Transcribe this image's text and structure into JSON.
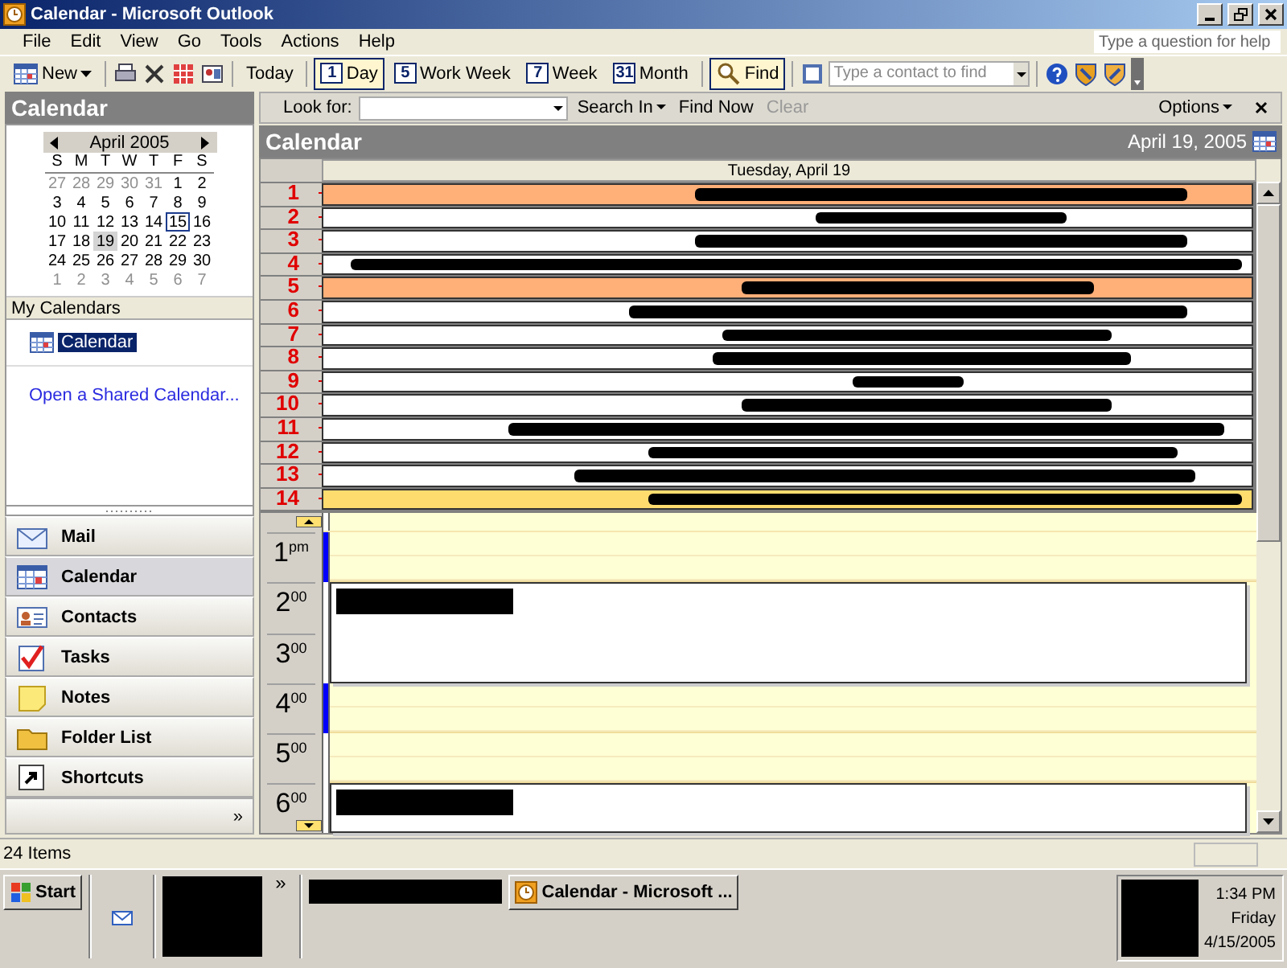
{
  "window": {
    "title": "Calendar - Microsoft Outlook"
  },
  "menu": [
    "File",
    "Edit",
    "View",
    "Go",
    "Tools",
    "Actions",
    "Help"
  ],
  "help_box": {
    "placeholder": "Type a question for help"
  },
  "toolbar": {
    "new_label": "New",
    "today_label": "Today",
    "views": [
      {
        "label": "Day",
        "icon_text": "1",
        "selected": true
      },
      {
        "label": "Work Week",
        "icon_text": "5",
        "selected": false
      },
      {
        "label": "Week",
        "icon_text": "7",
        "selected": false
      },
      {
        "label": "Month",
        "icon_text": "31",
        "selected": false
      }
    ],
    "find": {
      "label": "Find",
      "selected": true
    },
    "contact_search": {
      "placeholder": "Type a contact to find"
    }
  },
  "sidebar": {
    "title": "Calendar",
    "mini_calendar": {
      "month": "April 2005",
      "weekdays": [
        "S",
        "M",
        "T",
        "W",
        "T",
        "F",
        "S"
      ],
      "weeks": [
        [
          {
            "day": "27",
            "outside": true,
            "today": false,
            "selected": false
          },
          {
            "day": "28",
            "outside": true,
            "today": false,
            "selected": false
          },
          {
            "day": "29",
            "outside": true,
            "today": false,
            "selected": false
          },
          {
            "day": "30",
            "outside": true,
            "today": false,
            "selected": false
          },
          {
            "day": "31",
            "outside": true,
            "today": false,
            "selected": false
          },
          {
            "day": "1",
            "outside": false,
            "today": false,
            "selected": false
          },
          {
            "day": "2",
            "outside": false,
            "today": false,
            "selected": false
          }
        ],
        [
          {
            "day": "3",
            "outside": false,
            "today": false,
            "selected": false
          },
          {
            "day": "4",
            "outside": false,
            "today": false,
            "selected": false
          },
          {
            "day": "5",
            "outside": false,
            "today": false,
            "selected": false
          },
          {
            "day": "6",
            "outside": false,
            "today": false,
            "selected": false
          },
          {
            "day": "7",
            "outside": false,
            "today": false,
            "selected": false
          },
          {
            "day": "8",
            "outside": false,
            "today": false,
            "selected": false
          },
          {
            "day": "9",
            "outside": false,
            "today": false,
            "selected": false
          }
        ],
        [
          {
            "day": "10",
            "outside": false,
            "today": false,
            "selected": false
          },
          {
            "day": "11",
            "outside": false,
            "today": false,
            "selected": false
          },
          {
            "day": "12",
            "outside": false,
            "today": false,
            "selected": false
          },
          {
            "day": "13",
            "outside": false,
            "today": false,
            "selected": false
          },
          {
            "day": "14",
            "outside": false,
            "today": false,
            "selected": false
          },
          {
            "day": "15",
            "outside": false,
            "today": true,
            "selected": false
          },
          {
            "day": "16",
            "outside": false,
            "today": false,
            "selected": false
          }
        ],
        [
          {
            "day": "17",
            "outside": false,
            "today": false,
            "selected": false
          },
          {
            "day": "18",
            "outside": false,
            "today": false,
            "selected": false
          },
          {
            "day": "19",
            "outside": false,
            "today": false,
            "selected": true
          },
          {
            "day": "20",
            "outside": false,
            "today": false,
            "selected": false
          },
          {
            "day": "21",
            "outside": false,
            "today": false,
            "selected": false
          },
          {
            "day": "22",
            "outside": false,
            "today": false,
            "selected": false
          },
          {
            "day": "23",
            "outside": false,
            "today": false,
            "selected": false
          }
        ],
        [
          {
            "day": "24",
            "outside": false,
            "today": false,
            "selected": false
          },
          {
            "day": "25",
            "outside": false,
            "today": false,
            "selected": false
          },
          {
            "day": "26",
            "outside": false,
            "today": false,
            "selected": false
          },
          {
            "day": "27",
            "outside": false,
            "today": false,
            "selected": false
          },
          {
            "day": "28",
            "outside": false,
            "today": false,
            "selected": false
          },
          {
            "day": "29",
            "outside": false,
            "today": false,
            "selected": false
          },
          {
            "day": "30",
            "outside": false,
            "today": false,
            "selected": false
          }
        ],
        [
          {
            "day": "1",
            "outside": true,
            "today": false,
            "selected": false
          },
          {
            "day": "2",
            "outside": true,
            "today": false,
            "selected": false
          },
          {
            "day": "3",
            "outside": true,
            "today": false,
            "selected": false
          },
          {
            "day": "4",
            "outside": true,
            "today": false,
            "selected": false
          },
          {
            "day": "5",
            "outside": true,
            "today": false,
            "selected": false
          },
          {
            "day": "6",
            "outside": true,
            "today": false,
            "selected": false
          },
          {
            "day": "7",
            "outside": true,
            "today": false,
            "selected": false
          }
        ]
      ]
    },
    "my_calendars": {
      "title": "My Calendars",
      "items": [
        {
          "label": "Calendar",
          "selected": true
        }
      ]
    },
    "link": "Open a Shared Calendar..."
  },
  "nav": [
    {
      "label": "Mail",
      "kind": "mail",
      "selected": false
    },
    {
      "label": "Calendar",
      "kind": "calendar",
      "selected": true
    },
    {
      "label": "Contacts",
      "kind": "contacts",
      "selected": false
    },
    {
      "label": "Tasks",
      "kind": "tasks",
      "selected": false
    },
    {
      "label": "Notes",
      "kind": "notes",
      "selected": false
    },
    {
      "label": "Folder List",
      "kind": "folder",
      "selected": false
    },
    {
      "label": "Shortcuts",
      "kind": "shortcut",
      "selected": false
    }
  ],
  "nav_more": "»",
  "find_bar": {
    "look_for_label": "Look for:",
    "search_in": "Search In",
    "find_now": "Find Now",
    "clear": {
      "label": "Clear",
      "disabled": true
    },
    "options": "Options"
  },
  "calendar": {
    "title": "Calendar",
    "date": "April 19, 2005",
    "day_header": "Tuesday, April 19",
    "all_day_events": [
      {
        "number": "1",
        "color": "#ffaf78"
      },
      {
        "number": "2",
        "color": "#ffffff"
      },
      {
        "number": "3",
        "color": "#ffffff"
      },
      {
        "number": "4",
        "color": "#ffffff"
      },
      {
        "number": "5",
        "color": "#ffaf78"
      },
      {
        "number": "6",
        "color": "#ffffff"
      },
      {
        "number": "7",
        "color": "#ffffff"
      },
      {
        "number": "8",
        "color": "#ffffff"
      },
      {
        "number": "9",
        "color": "#ffffff"
      },
      {
        "number": "10",
        "color": "#ffffff"
      },
      {
        "number": "11",
        "color": "#ffffff"
      },
      {
        "number": "12",
        "color": "#ffffff"
      },
      {
        "number": "13",
        "color": "#ffffff"
      },
      {
        "number": "14",
        "color": "#ffdc6e"
      }
    ],
    "hours": [
      {
        "hour": "1",
        "suffix": "pm",
        "kind": "free",
        "busy": true
      },
      {
        "hour": "2",
        "suffix": "00",
        "kind": "appointment",
        "busy": false
      },
      {
        "hour": "3",
        "suffix": "00",
        "kind": "appointment",
        "busy": false
      },
      {
        "hour": "4",
        "suffix": "00",
        "kind": "free",
        "busy": true
      },
      {
        "hour": "5",
        "suffix": "00",
        "kind": "free",
        "busy": false
      },
      {
        "hour": "6",
        "suffix": "00",
        "kind": "appointment",
        "busy": false
      }
    ]
  },
  "status_bar": {
    "text": "24 Items"
  },
  "taskbar": {
    "start": "Start",
    "more": "»",
    "tasks": [
      {
        "label": "Calendar - Microsoft ...",
        "selected": false
      }
    ],
    "clock": [
      "1:34 PM",
      "Friday",
      "4/15/2005"
    ]
  }
}
